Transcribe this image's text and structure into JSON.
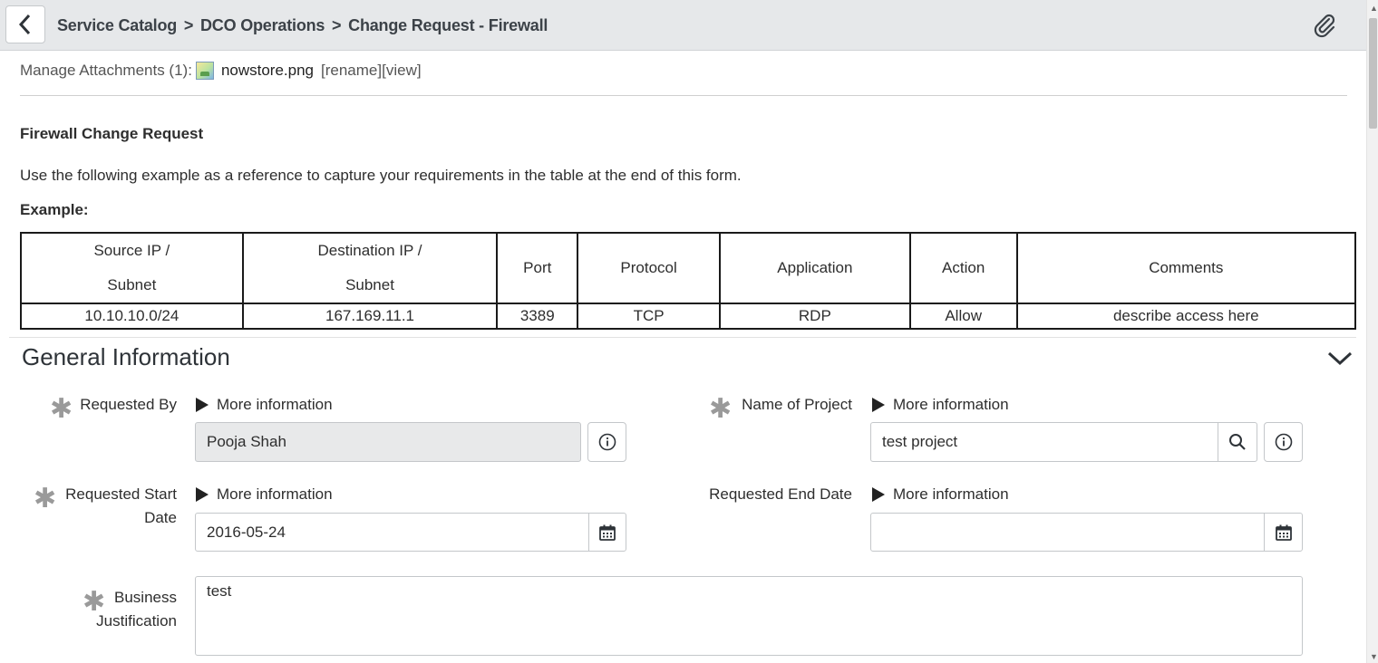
{
  "header": {
    "breadcrumb": [
      "Service Catalog",
      "DCO Operations",
      "Change Request - Firewall"
    ],
    "separator": ">",
    "back_icon": "chevron-left-icon",
    "attach_icon": "paperclip-icon"
  },
  "attachments": {
    "label": "Manage Attachments (1):",
    "file_name": "nowstore.png",
    "rename_label": "[rename]",
    "view_label": "[view]"
  },
  "form": {
    "title": "Firewall Change Request",
    "intro": "Use the following example as a reference to capture your requirements in the table at the end of this form.",
    "example_label": "Example:"
  },
  "example_table": {
    "headers": [
      {
        "line1": "Source IP /",
        "line2": "Subnet"
      },
      {
        "line1": "Destination IP /",
        "line2": "Subnet"
      },
      {
        "line1": "Port",
        "line2": ""
      },
      {
        "line1": "Protocol",
        "line2": ""
      },
      {
        "line1": "Application",
        "line2": ""
      },
      {
        "line1": "Action",
        "line2": ""
      },
      {
        "line1": "Comments",
        "line2": ""
      }
    ],
    "row": [
      "10.10.10.0/24",
      "167.169.11.1",
      "3389",
      "TCP",
      "RDP",
      "Allow",
      "describe access here"
    ]
  },
  "section": {
    "title": "General Information"
  },
  "fields": {
    "more_info": "More information",
    "requested_by": {
      "label": "Requested By",
      "value": "Pooja Shah"
    },
    "name_of_project": {
      "label": "Name of Project",
      "value": "test project"
    },
    "requested_start_date": {
      "label_line1": "Requested Start",
      "label_line2": "Date",
      "value": "2016-05-24"
    },
    "requested_end_date": {
      "label": "Requested End Date",
      "value": ""
    },
    "business_justification": {
      "label_line1": "Business",
      "label_line2": "Justification",
      "value": "test"
    }
  },
  "colors": {
    "header_bg": "#e6e8ea",
    "readonly_bg": "#e8e9ea",
    "required_mark": "#9a9a9a"
  }
}
